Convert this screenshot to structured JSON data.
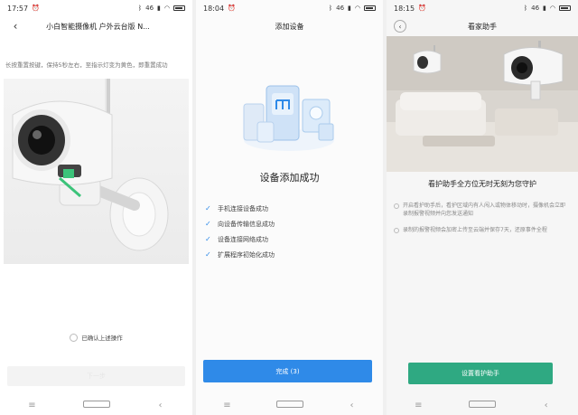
{
  "colors": {
    "primary_blue": "#2f8ae8",
    "teal": "#2fa982",
    "disabled_btn": "#f3f3f3"
  },
  "screens": [
    {
      "status": {
        "time": "17:57",
        "alarm_icon": "alarm-clock-icon",
        "bluetooth_icon": "bluetooth-icon",
        "signal": "46",
        "wifi_icon": "wifi-icon",
        "battery_icon": "battery-icon"
      },
      "nav": {
        "back_icon": "chevron-left-icon",
        "title": "小白智能摄像机 户外云台版 N..."
      },
      "heading": "小白智能摄像机 户外云台版 N系列",
      "instruction": "长按重置按键，保持5秒左右，至指示灯变为黄色，即重置成功",
      "confirm_label": "已确认上述操作",
      "next_button": "下一步"
    },
    {
      "status": {
        "time": "18:04",
        "alarm_icon": "alarm-clock-icon",
        "bluetooth_icon": "bluetooth-icon",
        "signal": "46",
        "wifi_icon": "wifi-icon",
        "battery_icon": "battery-icon"
      },
      "nav": {
        "title": "添加设备"
      },
      "success_title": "设备添加成功",
      "steps": [
        "手机连接设备成功",
        "向设备传输信息成功",
        "设备连接网络成功",
        "扩展程序初始化成功"
      ],
      "done_button": "完成 (3)"
    },
    {
      "status": {
        "time": "18:15",
        "alarm_icon": "alarm-clock-icon",
        "bluetooth_icon": "bluetooth-icon",
        "signal": "46",
        "wifi_icon": "wifi-icon",
        "battery_icon": "battery-icon"
      },
      "nav": {
        "back_icon": "chevron-left-icon",
        "title": "看家助手"
      },
      "hero_title": "看护助手全方位无时无刻为您守护",
      "bullets": [
        "开启看护助手后，看护区域内有人闯入或物体移动时，摄像机会立即录制报警视频并向您发送通知",
        "录制的报警视频会加密上传至云端并保存7天，还原事件全程"
      ],
      "setup_button": "设置看护助手"
    }
  ],
  "system_nav": {
    "menu_icon": "menu-icon",
    "home_icon": "home-square-icon",
    "back_icon": "back-triangle-icon"
  }
}
